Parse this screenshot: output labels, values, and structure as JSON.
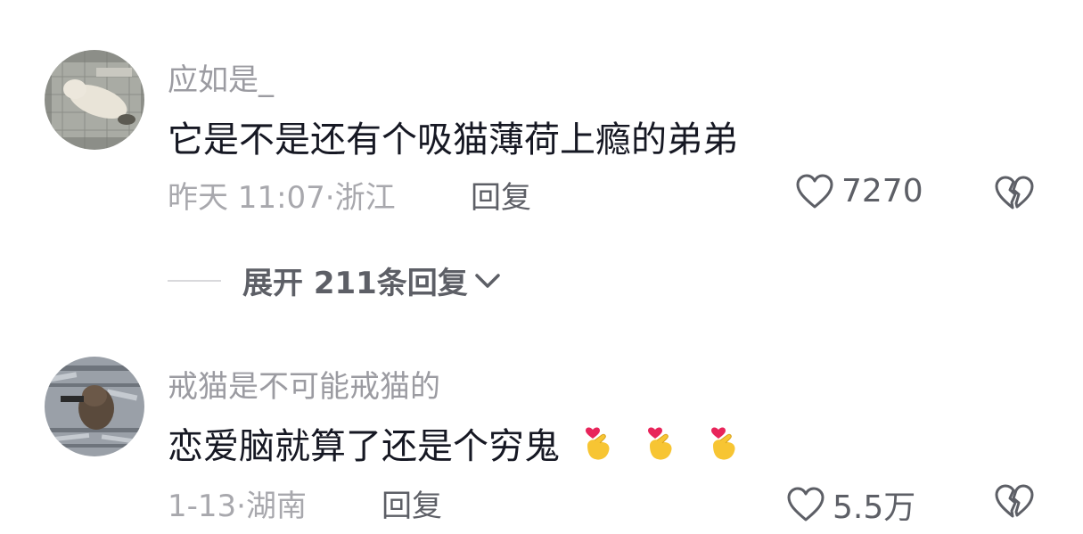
{
  "comments": [
    {
      "username": "应如是_",
      "text": "它是不是还有个吸猫薄荷上瘾的弟弟",
      "time": "昨天 11:07",
      "location": "浙江",
      "separator": "·",
      "reply_label": "回复",
      "likes": "7270",
      "avatar_icon": "cat-lying-avatar",
      "emojis": []
    },
    {
      "username": "戒猫是不可能戒猫的",
      "text": "恋爱脑就算了还是个穷鬼",
      "time": "1-13",
      "location": "湖南",
      "separator": "·",
      "reply_label": "回复",
      "likes": "5.5万",
      "avatar_icon": "cat-gun-avatar",
      "emojis": [
        "finger-heart-emoji",
        "finger-heart-emoji",
        "finger-heart-emoji"
      ]
    }
  ],
  "expand_replies": {
    "label": "展开 211条回复"
  },
  "colors": {
    "text": "#161823",
    "muted": "#9b9ba1",
    "action": "#5d5f66"
  }
}
